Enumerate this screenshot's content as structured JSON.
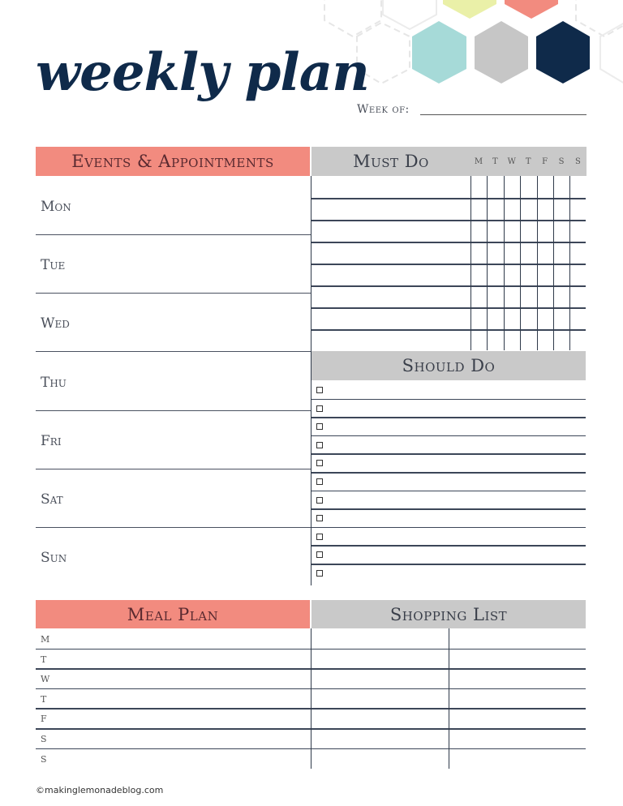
{
  "title": "weekly plan",
  "week_of": {
    "label": "Week of:",
    "value": ""
  },
  "colors": {
    "coral": "#f28b7f",
    "grey": "#c9c9c9",
    "navy": "#0f2a4a",
    "teal": "#a6dad8",
    "yellow": "#eaf0a8"
  },
  "events": {
    "header": "Events & Appointments",
    "days": [
      "Mon",
      "Tue",
      "Wed",
      "Thu",
      "Fri",
      "Sat",
      "Sun"
    ]
  },
  "must_do": {
    "header": "Must Do",
    "day_columns": [
      "M",
      "T",
      "W",
      "T",
      "F",
      "S",
      "S"
    ],
    "rows": 8
  },
  "should_do": {
    "header": "Should Do",
    "items": 11
  },
  "meal_plan": {
    "header": "Meal Plan",
    "days": [
      "M",
      "T",
      "W",
      "T",
      "F",
      "S",
      "S"
    ]
  },
  "shopping_list": {
    "header": "Shopping List",
    "rows": 7
  },
  "footer": {
    "copyright": "©makinglemonadeblog.com"
  }
}
